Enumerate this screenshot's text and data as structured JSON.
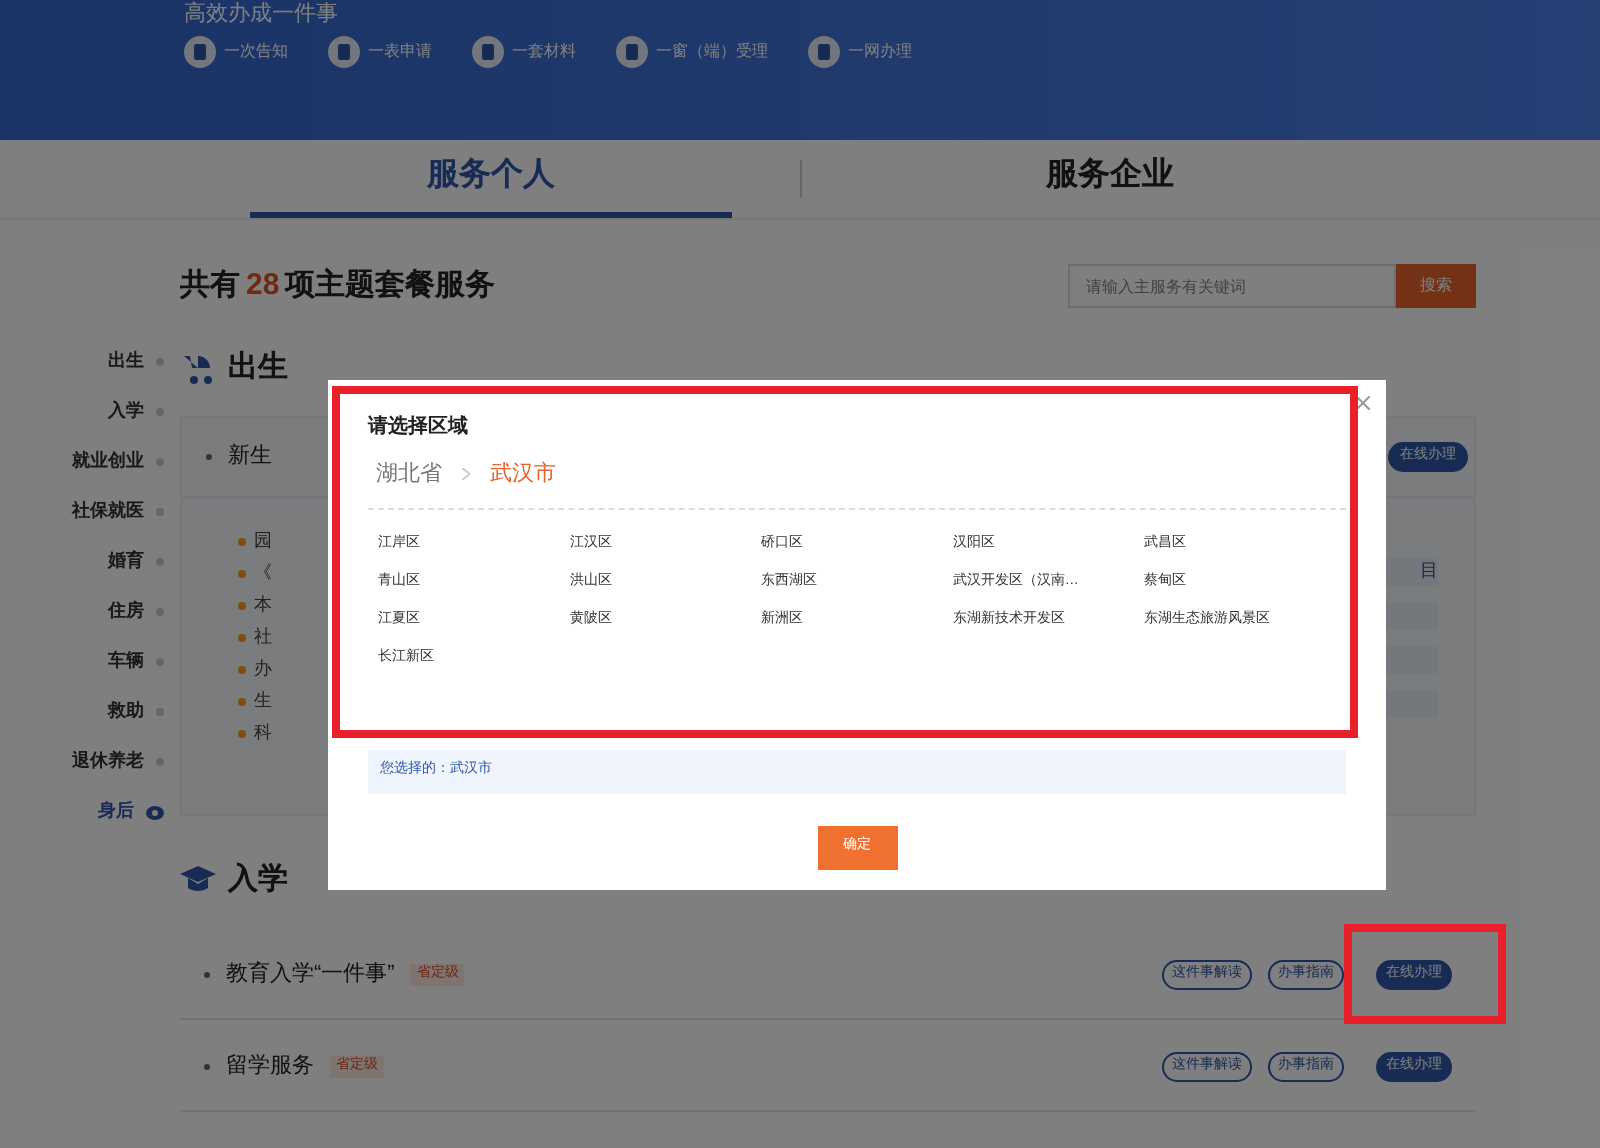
{
  "banner": {
    "title": "高效办成一件事",
    "features": [
      {
        "label": "一次告知"
      },
      {
        "label": "一表申请"
      },
      {
        "label": "一套材料"
      },
      {
        "label": "一窗（端）受理"
      },
      {
        "label": "一网办理"
      }
    ]
  },
  "tabs": [
    {
      "label": "服务个人",
      "selected": true
    },
    {
      "label": "服务企业",
      "selected": false
    }
  ],
  "summary": {
    "prefix": "共有",
    "count": "28",
    "suffix": "项主题套餐服务"
  },
  "search": {
    "placeholder": "请输入主服务有关键词",
    "button": "搜索"
  },
  "sidebar": {
    "items": [
      {
        "label": "出生",
        "selected": false
      },
      {
        "label": "入学",
        "selected": false
      },
      {
        "label": "就业创业",
        "selected": false
      },
      {
        "label": "社保就医",
        "selected": false
      },
      {
        "label": "婚育",
        "selected": false
      },
      {
        "label": "住房",
        "selected": false
      },
      {
        "label": "车辆",
        "selected": false
      },
      {
        "label": "救助",
        "selected": false
      },
      {
        "label": "退休养老",
        "selected": false
      },
      {
        "label": "身后",
        "selected": true
      }
    ]
  },
  "sections": [
    {
      "title": "出生",
      "card": {
        "title": "新生",
        "action": "在线办理",
        "bullets": [
          "园",
          "《",
          "本",
          "社",
          "办",
          "生",
          "科"
        ],
        "side_text": "目"
      }
    },
    {
      "title": "入学",
      "rows": [
        {
          "title": "教育入学“一件事”",
          "badge": "省定级",
          "buttons": [
            {
              "label": "这件事解读",
              "primary": false
            },
            {
              "label": "办事指南",
              "primary": false
            },
            {
              "label": "在线办理",
              "primary": true
            }
          ]
        },
        {
          "title": "留学服务",
          "badge": "省定级",
          "buttons": [
            {
              "label": "这件事解读",
              "primary": false
            },
            {
              "label": "办事指南",
              "primary": false
            },
            {
              "label": "在线办理",
              "primary": true
            }
          ]
        }
      ]
    }
  ],
  "dialog": {
    "title": "请选择区域",
    "breadcrumb": [
      {
        "label": "湖北省",
        "selected": false
      },
      {
        "label": "武汉市",
        "selected": true
      }
    ],
    "districts": [
      "江岸区",
      "江汉区",
      "硚口区",
      "汉阳区",
      "武昌区",
      "青山区",
      "洪山区",
      "东西湖区",
      "武汉开发区（汉南…",
      "蔡甸区",
      "江夏区",
      "黄陂区",
      "新洲区",
      "东湖新技术开发区",
      "东湖生态旅游风景区",
      "长江新区"
    ],
    "selection_note": "您选择的：武汉市",
    "confirm": "确定"
  }
}
